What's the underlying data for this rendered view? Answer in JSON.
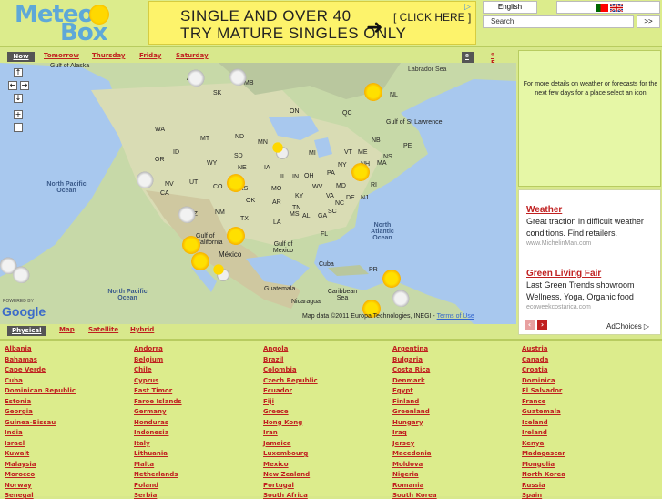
{
  "logo": {
    "line1": "Meteo",
    "line2": "Box"
  },
  "ad_banner": {
    "line1": "SINGLE AND OVER 40",
    "line2": "TRY MATURE SINGLES ONLY",
    "cta": "[ CLICK HERE ]"
  },
  "language": "English",
  "search": {
    "placeholder": "Search",
    "button": ">>"
  },
  "day_tabs": [
    "Now",
    "Tomorrow",
    "Thursday",
    "Friday",
    "Saturday"
  ],
  "units": [
    "º C",
    "º F"
  ],
  "map_types": [
    "Physical",
    "Map",
    "Satellite",
    "Hybrid"
  ],
  "map": {
    "labels": [
      "Gulf of Alaska",
      "AB",
      "SK",
      "MB",
      "ON",
      "QC",
      "NL",
      "Labrador Sea",
      "Gulf of St Lawrence",
      "PE",
      "NB",
      "NS",
      "WA",
      "MT",
      "ND",
      "MN",
      "ID",
      "SD",
      "WI",
      "MI",
      "VT",
      "ME",
      "OR",
      "WY",
      "IA",
      "NY",
      "NH",
      "MA",
      "NV",
      "UT",
      "NE",
      "IL",
      "IN",
      "OH",
      "PA",
      "CT",
      "RI",
      "CO",
      "KS",
      "MO",
      "KY",
      "WV",
      "NJ",
      "DE",
      "CA",
      "AZ",
      "NM",
      "OK",
      "AR",
      "TN",
      "VA",
      "MD",
      "TX",
      "LA",
      "MS",
      "AL",
      "GA",
      "SC",
      "NC",
      "FL",
      "Gulf of California",
      "México",
      "Gulf of Mexico",
      "Cuba",
      "PR",
      "Guatemala",
      "Nicaragua",
      "Caribbean Sea"
    ],
    "oceans": [
      "North Pacific Ocean",
      "North Atlantic Ocean",
      "North Pacific Ocean"
    ],
    "powered_by": "POWERED BY",
    "google": "Google",
    "attribution": "Map data ©2011 Europa Technologies, INEGI -",
    "terms": "Terms of Use"
  },
  "info_text": "For more details on weather or forecasts for the next few days for a place select an icon",
  "side_ads": [
    {
      "title": "Weather",
      "body": "Great traction in difficult weather conditions. Find retailers.",
      "url": "www.MichelinMan.com"
    },
    {
      "title": "Green Living Fair",
      "body": "Last Green Trends showroom Wellness, Yoga, Organic food",
      "url": "ecoweekcostarica.com"
    }
  ],
  "adchoices": "AdChoices",
  "countries": [
    [
      "Albania",
      "Bahamas",
      "Cape Verde",
      "Cuba",
      "Dominican Republic",
      "Estonia",
      "Georgia",
      "Guinea-Bissau",
      "India",
      "Israel",
      "Kuwait",
      "Malaysia",
      "Morocco",
      "Norway",
      "Senegal"
    ],
    [
      "Andorra",
      "Belgium",
      "Chile",
      "Cyprus",
      "East Timor",
      "Faroe Islands",
      "Germany",
      "Honduras",
      "Indonesia",
      "Italy",
      "Lithuania",
      "Malta",
      "Netherlands",
      "Poland",
      "Serbia"
    ],
    [
      "Angola",
      "Brazil",
      "Colombia",
      "Czech Republic",
      "Ecuador",
      "Fiji",
      "Greece",
      "Hong Kong",
      "Iran",
      "Jamaica",
      "Luxembourg",
      "Mexico",
      "New Zealand",
      "Portugal",
      "South Africa"
    ],
    [
      "Argentina",
      "Bulgaria",
      "Costa Rica",
      "Denmark",
      "Egypt",
      "Finland",
      "Greenland",
      "Hungary",
      "Iraq",
      "Jersey",
      "Macedonia",
      "Moldova",
      "Nigeria",
      "Romania",
      "South Korea"
    ],
    [
      "Austria",
      "Canada",
      "Croatia",
      "Dominica",
      "El Salvador",
      "France",
      "Guatemala",
      "Iceland",
      "Ireland",
      "Kenya",
      "Madagascar",
      "Mongolia",
      "North Korea",
      "Russia",
      "Spain"
    ]
  ]
}
